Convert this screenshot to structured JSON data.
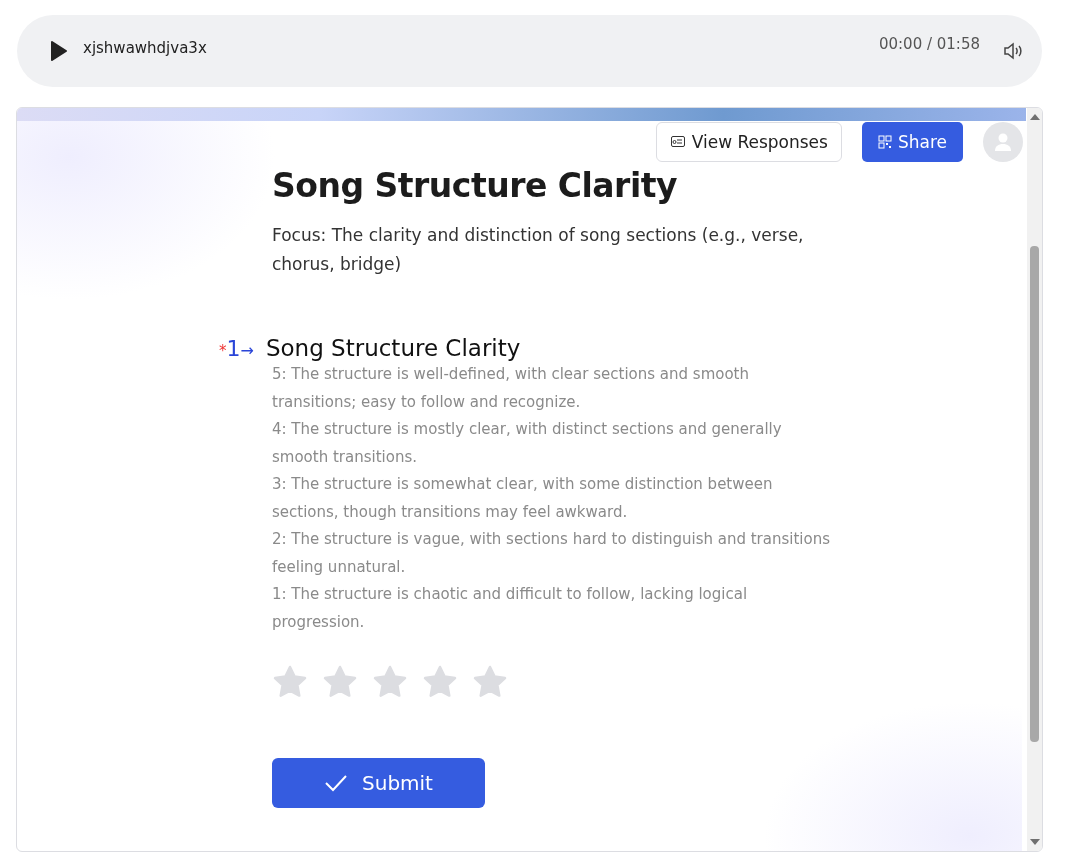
{
  "player": {
    "title": "xjshwawhdjva3x",
    "time": "00:00 / 01:58"
  },
  "toolbar": {
    "view_responses": "View Responses",
    "share": "Share"
  },
  "form": {
    "title": "Song Structure Clarity",
    "description": "Focus: The clarity and distinction of song sections (e.g., verse, chorus, bridge)"
  },
  "questions": [
    {
      "required_mark": "*",
      "number": "1",
      "arrow": "→",
      "title": "Song Structure Clarity",
      "criteria": [
        "5: The structure is well-defined, with clear sections and smooth transitions; easy to follow and recognize.",
        "4: The structure is mostly clear, with distinct sections and generally smooth transitions.",
        "3: The structure is somewhat clear, with some distinction between sections, though transitions may feel awkward.",
        "2: The structure is vague, with sections hard to distinguish and transitions feeling unnatural.",
        "1: The structure is chaotic and difficult to follow, lacking logical progression."
      ],
      "stars": 0
    }
  ],
  "submit": "Submit"
}
